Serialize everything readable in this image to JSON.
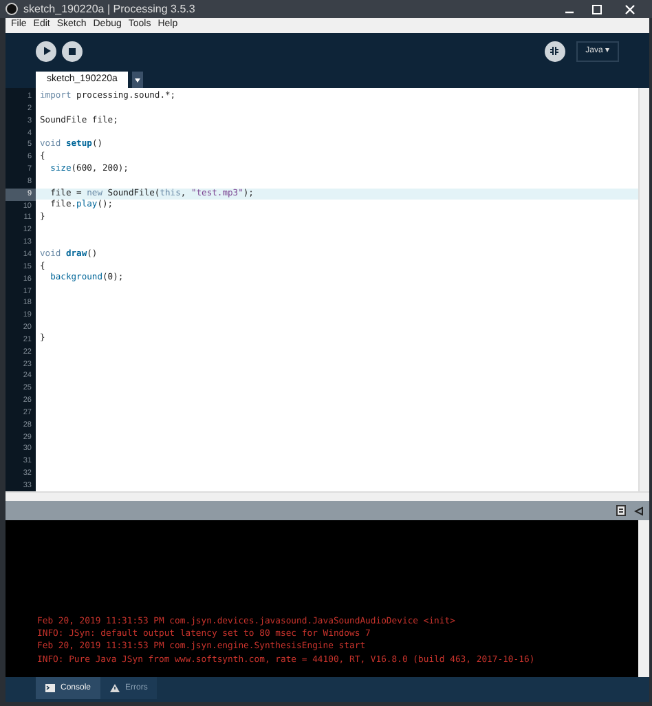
{
  "window": {
    "title": "sketch_190220a | Processing 3.5.3"
  },
  "menu": [
    "File",
    "Edit",
    "Sketch",
    "Debug",
    "Tools",
    "Help"
  ],
  "toolbar": {
    "mode": "Java ▾"
  },
  "tabs": [
    {
      "label": "sketch_190220a",
      "selected": true
    }
  ],
  "editor": {
    "lines": [
      {
        "number": "1",
        "current": false,
        "tokens": [
          {
            "kind": "keyword",
            "text": "import"
          },
          {
            "kind": "plain",
            "text": " processing.sound.*;"
          }
        ]
      },
      {
        "number": "2",
        "current": false
      },
      {
        "number": "3",
        "current": false,
        "tokens": [
          {
            "kind": "plain",
            "text": "SoundFile file;"
          }
        ]
      },
      {
        "number": "4",
        "current": false
      },
      {
        "number": "5",
        "current": false,
        "tokens": [
          {
            "kind": "keyword",
            "text": "void "
          },
          {
            "kind": "function",
            "text": "setup"
          },
          {
            "kind": "plain",
            "text": "()"
          }
        ]
      },
      {
        "number": "6",
        "current": false,
        "tokens": [
          {
            "kind": "plain",
            "text": "{"
          }
        ]
      },
      {
        "number": "7",
        "current": false,
        "tokens": [
          {
            "kind": "builtin",
            "text": "  size"
          },
          {
            "kind": "plain",
            "text": "(600, 200);"
          }
        ]
      },
      {
        "number": "8",
        "current": false
      },
      {
        "number": "9",
        "current": true,
        "tokens": [
          {
            "kind": "plain",
            "text": "  file = "
          },
          {
            "kind": "keyword",
            "text": "new"
          },
          {
            "kind": "plain",
            "text": " SoundFile("
          },
          {
            "kind": "keyword",
            "text": "this"
          },
          {
            "kind": "plain",
            "text": ", "
          },
          {
            "kind": "string",
            "text": "\"test.mp3\""
          },
          {
            "kind": "plain",
            "text": ");"
          }
        ]
      },
      {
        "number": "10",
        "current": false,
        "tokens": [
          {
            "kind": "plain",
            "text": "  file."
          },
          {
            "kind": "builtin",
            "text": "play"
          },
          {
            "kind": "plain",
            "text": "();"
          }
        ]
      },
      {
        "number": "11",
        "current": false,
        "tokens": [
          {
            "kind": "plain",
            "text": "}"
          }
        ]
      },
      {
        "number": "12",
        "current": false
      },
      {
        "number": "13",
        "current": false
      },
      {
        "number": "14",
        "current": false,
        "tokens": [
          {
            "kind": "keyword",
            "text": "void "
          },
          {
            "kind": "function",
            "text": "draw"
          },
          {
            "kind": "plain",
            "text": "()"
          }
        ]
      },
      {
        "number": "15",
        "current": false,
        "tokens": [
          {
            "kind": "plain",
            "text": "{"
          }
        ]
      },
      {
        "number": "16",
        "current": false,
        "tokens": [
          {
            "kind": "builtin",
            "text": "  background"
          },
          {
            "kind": "plain",
            "text": "(0);"
          }
        ]
      },
      {
        "number": "17",
        "current": false
      },
      {
        "number": "18",
        "current": false
      },
      {
        "number": "19",
        "current": false
      },
      {
        "number": "20",
        "current": false
      },
      {
        "number": "21",
        "current": false,
        "tokens": [
          {
            "kind": "plain",
            "text": "}"
          }
        ]
      },
      {
        "number": "22",
        "current": false
      },
      {
        "number": "23",
        "current": false
      },
      {
        "number": "24",
        "current": false
      },
      {
        "number": "25",
        "current": false
      },
      {
        "number": "26",
        "current": false
      },
      {
        "number": "27",
        "current": false
      },
      {
        "number": "28",
        "current": false
      },
      {
        "number": "29",
        "current": false
      },
      {
        "number": "30",
        "current": false
      },
      {
        "number": "31",
        "current": false
      },
      {
        "number": "32",
        "current": false
      },
      {
        "number": "33",
        "current": false
      }
    ]
  },
  "console": {
    "lines": [
      "Feb 20, 2019 11:31:53 PM com.jsyn.devices.javasound.JavaSoundAudioDevice <init>",
      "INFO: JSyn: default output latency set to 80 msec for Windows 7",
      "Feb 20, 2019 11:31:53 PM com.jsyn.engine.SynthesisEngine start",
      "INFO: Pure Java JSyn from www.softsynth.com, rate = 44100, RT, V16.8.0 (build 463, 2017-10-16)"
    ]
  },
  "bottom_tabs": [
    {
      "label": "Console",
      "kind": "console",
      "selected": true
    },
    {
      "label": "Errors",
      "kind": "errors",
      "selected": false
    }
  ]
}
